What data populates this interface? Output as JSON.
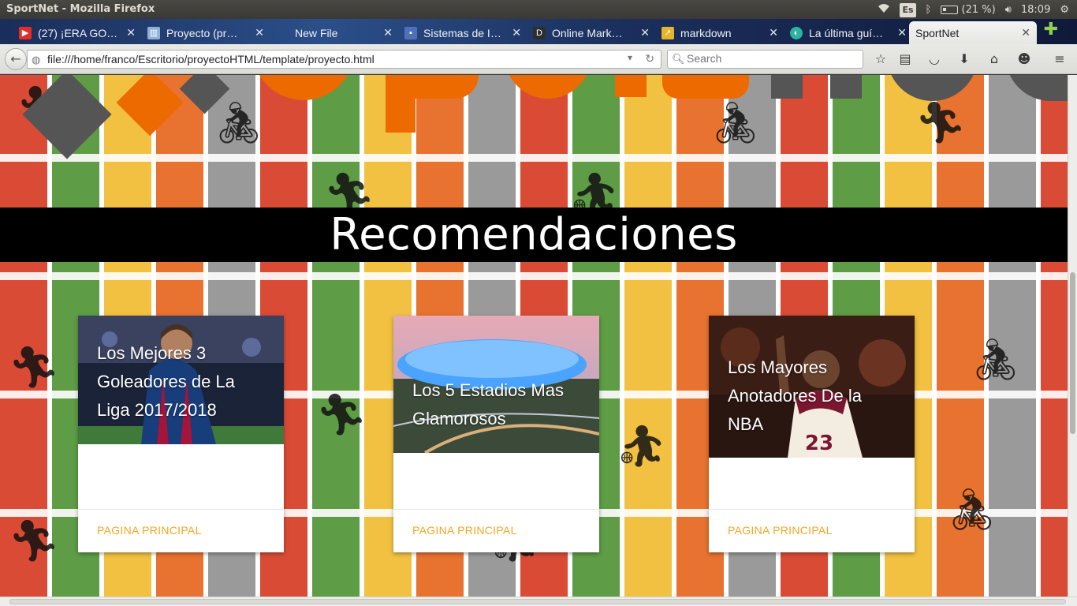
{
  "os_panel": {
    "window_title": "SportNet - Mozilla Firefox",
    "keyboard_layout": "Es",
    "battery": "(21 %)",
    "clock": "18:09"
  },
  "tabs": [
    {
      "label": "(27) ¡ERA GO…",
      "icon": "youtube-icon",
      "color": "#e52d27"
    },
    {
      "label": "Proyecto (pr…",
      "icon": "trello-icon",
      "color": "#8fb1d6"
    },
    {
      "label": "New File",
      "icon": "file-icon",
      "color": "#1b2f5c"
    },
    {
      "label": "Sistemas de I…",
      "icon": "contact-icon",
      "color": "#4f6fb8"
    },
    {
      "label": "Online Mark…",
      "icon": "dillinger-icon",
      "color": "#2e2e2e"
    },
    {
      "label": "markdown",
      "icon": "markdown-icon",
      "color": "#e8b42a"
    },
    {
      "label": "La última guí…",
      "icon": "cloud-icon",
      "color": "#2bb3a0"
    },
    {
      "label": "SportNet",
      "icon": "",
      "color": "",
      "active": true
    }
  ],
  "navbar": {
    "url": "file:///home/franco/Escritorio/proyectoHTML/template/proyecto.html",
    "search_placeholder": "Search"
  },
  "page": {
    "heading": "Recomendaciones",
    "cards": [
      {
        "title": "Los Mejores 3 Goleadores de La Liga 2017/2018",
        "link": "PAGINA PRINCIPAL",
        "image": "soccer-player-photo"
      },
      {
        "title": "Los 5 Estadios Mas Glamorosos",
        "link": "PAGINA PRINCIPAL",
        "image": "stadium-photo"
      },
      {
        "title": "Los Mayores Anotadores De la NBA",
        "link": "PAGINA PRINCIPAL",
        "image": "basketball-player-photo"
      }
    ]
  },
  "colors": {
    "banner_bg": "#000000",
    "link_color": "#f5a623",
    "logo_orange": "#ec6a00",
    "logo_gray": "#555555"
  }
}
